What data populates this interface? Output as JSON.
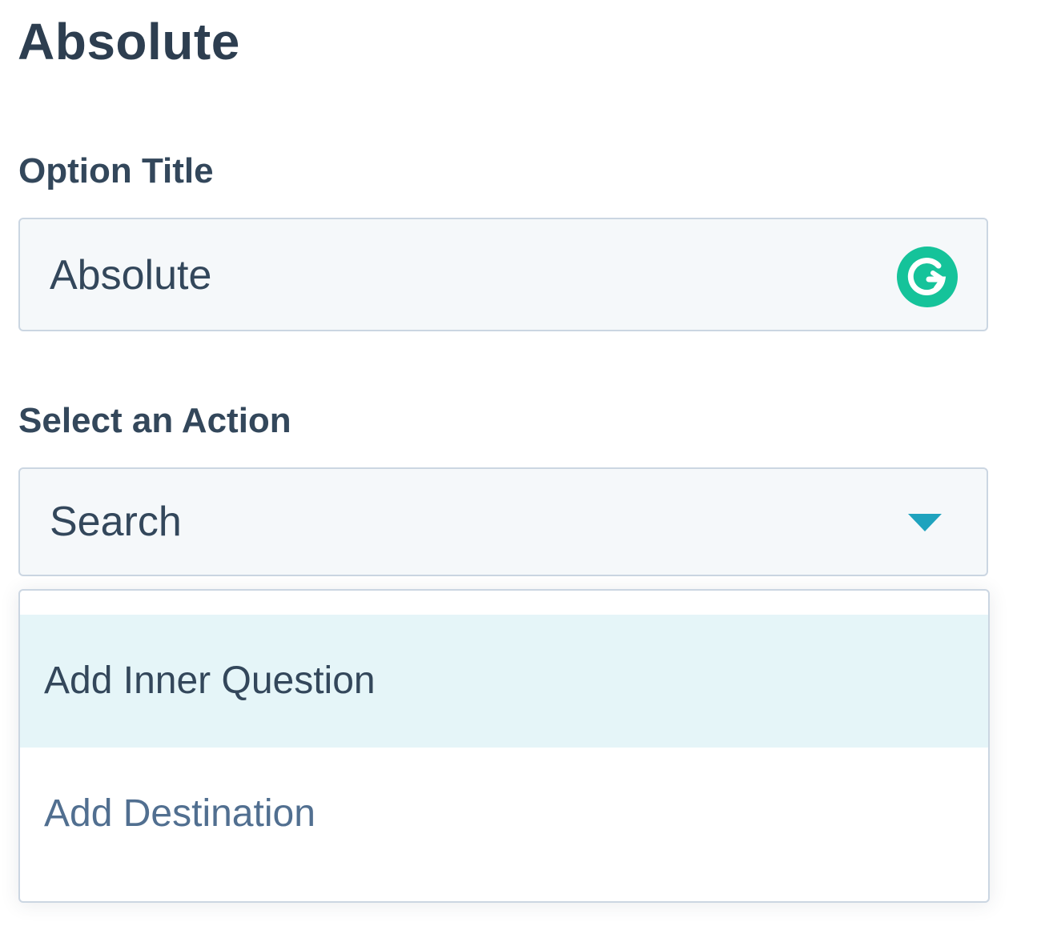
{
  "page": {
    "title": "Absolute"
  },
  "option_title": {
    "label": "Option Title",
    "value": "Absolute",
    "assist_icon": "grammarly-icon"
  },
  "action": {
    "label": "Select an Action",
    "selected": "Search",
    "caret_icon": "caret-down-icon",
    "options": [
      {
        "label": "Add Inner Question",
        "highlighted": true
      },
      {
        "label": "Add Destination",
        "highlighted": false
      }
    ]
  },
  "colors": {
    "text_primary": "#33475b",
    "input_bg": "#f5f8fa",
    "border": "#cbd6e2",
    "accent": "#1fa3be",
    "highlight_bg": "#e5f5f8",
    "grammarly": "#15c39a"
  }
}
